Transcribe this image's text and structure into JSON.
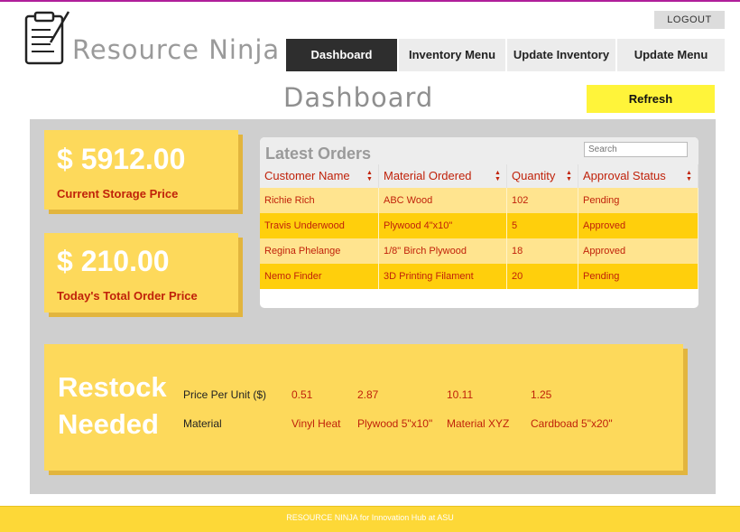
{
  "brand": "Resource Ninja",
  "header": {
    "logout_label": "LOGOUT"
  },
  "nav": {
    "tabs": [
      {
        "label": "Dashboard",
        "active": true
      },
      {
        "label": "Inventory Menu",
        "active": false
      },
      {
        "label": "Update Inventory",
        "active": false
      },
      {
        "label": "Update Menu",
        "active": false
      }
    ]
  },
  "page": {
    "title": "Dashboard",
    "refresh_label": "Refresh"
  },
  "stats": [
    {
      "value": "$ 5912.00",
      "label": "Current Storage Price"
    },
    {
      "value": "$ 210.00",
      "label": "Today's Total Order Price"
    }
  ],
  "orders": {
    "title": "Latest Orders",
    "search_placeholder": "Search",
    "columns": [
      "Customer Name",
      "Material Ordered",
      "Quantity",
      "Approval Status"
    ],
    "rows": [
      [
        "Richie Rich",
        "ABC Wood",
        "102",
        "Pending"
      ],
      [
        "Travis Underwood",
        "Plywood 4\"x10\"",
        "5",
        "Approved"
      ],
      [
        "Regina Phelange",
        "1/8\" Birch Plywood",
        "18",
        "Approved"
      ],
      [
        "Nemo Finder",
        "3D Printing Filament",
        "20",
        "Pending"
      ]
    ]
  },
  "restock": {
    "title_line1": "Restock",
    "title_line2": "Needed",
    "price_label": "Price Per Unit ($)",
    "material_label": "Material",
    "items": [
      {
        "price": "0.51",
        "material": "Vinyl Heat"
      },
      {
        "price": "2.87",
        "material": "Plywood 5\"x10\""
      },
      {
        "price": "10.11",
        "material": "Material XYZ"
      },
      {
        "price": "1.25",
        "material": "Cardboad 5\"x20\""
      }
    ]
  },
  "footer": {
    "text": "RESOURCE NINJA for Innovation Hub at ASU"
  },
  "colors": {
    "accent_yellow": "#fdd95b",
    "refresh_yellow": "#fff43a",
    "text_red": "#c0220a",
    "nav_active": "#2e2e2e",
    "top_line": "#b01f9a"
  }
}
